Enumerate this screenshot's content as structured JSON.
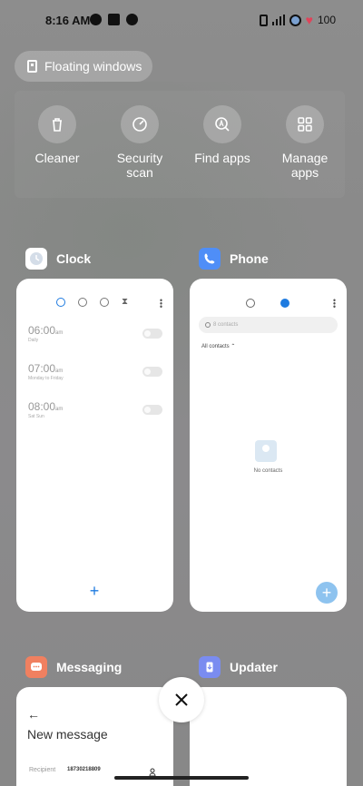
{
  "status_bar": {
    "time": "8:16 AM",
    "battery": "100"
  },
  "floating_windows": {
    "label": "Floating windows"
  },
  "quick_tools": [
    {
      "label": "Cleaner",
      "icon": "trash-icon"
    },
    {
      "label": "Security scan",
      "icon": "security-gauge-icon"
    },
    {
      "label": "Find apps",
      "icon": "find-apps-icon"
    },
    {
      "label": "Manage apps",
      "icon": "grid-icon"
    }
  ],
  "apps": {
    "clock": {
      "name": "Clock",
      "alarms": [
        {
          "time": "06:00",
          "ampm": "am",
          "repeat": "Daily"
        },
        {
          "time": "07:00",
          "ampm": "am",
          "repeat": "Monday to Friday"
        },
        {
          "time": "08:00",
          "ampm": "am",
          "repeat": "Sat Sun"
        }
      ]
    },
    "phone": {
      "name": "Phone",
      "search_placeholder": "8 contacts",
      "filter": "All contacts",
      "empty_text": "No contacts"
    },
    "messaging": {
      "name": "Messaging",
      "back": "←",
      "title": "New message",
      "recipient_label": "Recipient",
      "recipient_value": "18730218809"
    },
    "updater": {
      "name": "Updater"
    }
  },
  "colors": {
    "accent": "#1e7be0",
    "clock_icon_bg": "#ffffff",
    "phone_icon_bg": "#4f8ef7",
    "messaging_icon_bg": "#f08060",
    "updater_icon_bg": "#7a8cf0"
  }
}
